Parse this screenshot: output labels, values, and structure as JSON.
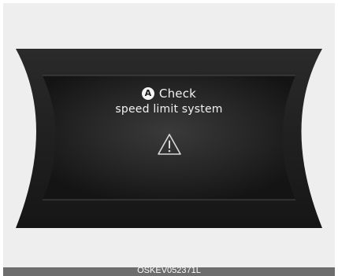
{
  "message": {
    "badge_letter": "A",
    "title": "Check",
    "subtitle": "speed limit system"
  },
  "icons": {
    "warning": "warning-triangle-icon"
  },
  "caption": {
    "code": "OSKEV052371L"
  },
  "colors": {
    "display_background": "#1c1c1c",
    "text": "#f2f2f2",
    "page_background": "#eeeeee",
    "caption_bar": "#6d6d6d"
  }
}
